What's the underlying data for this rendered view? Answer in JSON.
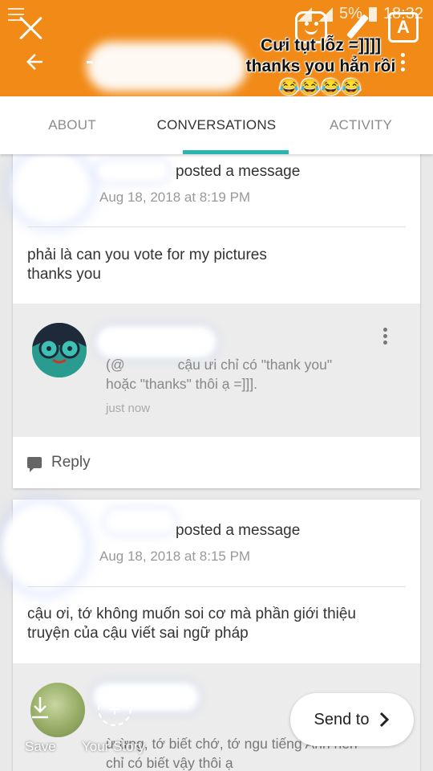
{
  "header": {
    "dash": "-",
    "caption_line1": "Cưi tụt lỗz =]]]]",
    "caption_line2": "thanks you hẳn rồi",
    "caption_emojis": "😂😂😂😂",
    "text_tool_label": "A"
  },
  "status_bar": {
    "battery": "5%",
    "time": "18:32"
  },
  "tabs": [
    {
      "label": "ABOUT"
    },
    {
      "label": "CONVERSATIONS"
    },
    {
      "label": "ACTIVITY"
    }
  ],
  "cards": [
    {
      "posted": "posted a message",
      "date": "Aug 18, 2018 at 8:19 PM",
      "message_line1": "phải là can you vote for my pictures",
      "message_line2": "thanks you",
      "reply": {
        "text_line1": "cậu ưi chỉ có \"thank you\"",
        "text_line2": "hoặc \"thanks\" thôi ạ =]]].",
        "time": "just now"
      },
      "reply_button": "Reply"
    },
    {
      "posted": "posted a message",
      "date": "Aug 18, 2018 at 8:15 PM",
      "message_line1": "cậu ơi, tớ không muốn soi cơ mà phần giới thiệu",
      "message_line2": "truyện của cậu viết sai ngữ pháp",
      "reply": {
        "text_line1": "ừ ừng, tớ biết chớ, tớ ngu tiếng Anh nên",
        "text_line2": "chỉ có biết vậy thôi ạ"
      }
    }
  ],
  "bottom": {
    "save_label": "Save",
    "your_story_label": "Your Story",
    "send_label": "Send to"
  },
  "colors": {
    "header": "#f18a17",
    "tab_indicator": "#2bb5b0",
    "avatar": "#2aa69a"
  }
}
